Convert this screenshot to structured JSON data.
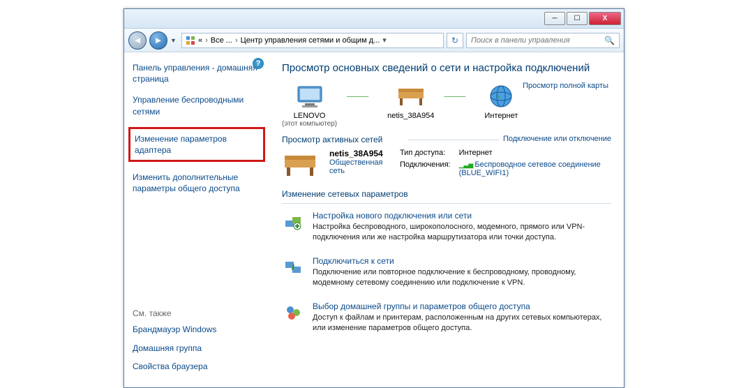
{
  "breadcrumb": {
    "chevrons": "«",
    "seg1": "Все ...",
    "seg2": "Центр управления сетями и общим д..."
  },
  "search": {
    "placeholder": "Поиск в панели управления"
  },
  "sidebar": {
    "home": "Панель управления - домашняя страница",
    "wireless": "Управление беспроводными сетями",
    "adapter": "Изменение параметров адаптера",
    "sharing": "Изменить дополнительные параметры общего доступа",
    "see_also_title": "См. также",
    "firewall": "Брандмауэр Windows",
    "homegroup": "Домашняя группа",
    "browser": "Свойства браузера"
  },
  "content": {
    "h1": "Просмотр основных сведений о сети и настройка подключений",
    "view_full": "Просмотр полной карты",
    "node1": "LENOVO",
    "node1_sub": "(этот компьютер)",
    "node2": "netis_38A954",
    "node3": "Интернет",
    "active_title": "Просмотр активных сетей",
    "conn_link": "Подключение или отключение",
    "net_name": "netis_38A954",
    "net_type": "Общественная сеть",
    "k_access": "Тип доступа:",
    "v_access": "Интернет",
    "k_conn": "Подключения:",
    "v_conn": "Беспроводное сетевое соединение (BLUE_WIFI1)",
    "params_title": "Изменение сетевых параметров",
    "p1_t": "Настройка нового подключения или сети",
    "p1_d": "Настройка беспроводного, широкополосного, модемного, прямого или VPN-подключения или же настройка маршрутизатора или точки доступа.",
    "p2_t": "Подключиться к сети",
    "p2_d": "Подключение или повторное подключение к беспроводному, проводному, модемному сетевому соединению или подключение к VPN.",
    "p3_t": "Выбор домашней группы и параметров общего доступа",
    "p3_d": "Доступ к файлам и принтерам, расположенным на других сетевых компьютерах, или изменение параметров общего доступа."
  }
}
